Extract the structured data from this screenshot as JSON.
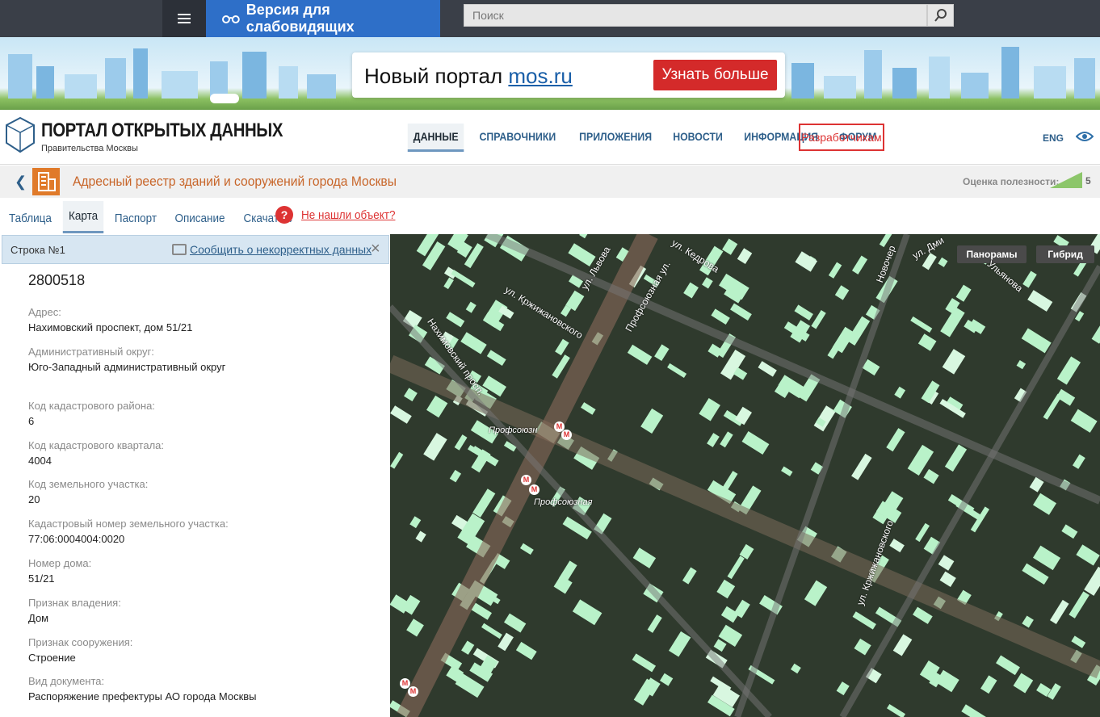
{
  "topbar": {
    "accessibility_label": "Версия для слабовидящих",
    "search_placeholder": "Поиск"
  },
  "banner": {
    "text_prefix": "Новый портал ",
    "text_link": "mos.ru",
    "button": "Узнать больше"
  },
  "header": {
    "title": "ПОРТАЛ ОТКРЫТЫХ ДАННЫХ",
    "subtitle": "Правительства Москвы",
    "nav": [
      "ДАННЫЕ",
      "СПРАВОЧНИКИ",
      "ПРИЛОЖЕНИЯ",
      "НОВОСТИ",
      "ИНФОРМАЦИЯ",
      "ФОРУМ"
    ],
    "dev_button": "Разработчикам",
    "lang": "ENG"
  },
  "dataset": {
    "title": "Адресный реестр зданий и сооружений города Москвы",
    "rating_label": "Оценка полезности:",
    "rating_value": "5"
  },
  "tabs": {
    "items": [
      "Таблица",
      "Карта",
      "Паспорт",
      "Описание",
      "Скачать"
    ],
    "not_found": "Не нашли объект?",
    "help": "?"
  },
  "panel": {
    "row_label": "Строка №1",
    "report_link": "Сообщить о некорректных данных",
    "id": "2800518",
    "fields": [
      {
        "label": "Адрес:",
        "value": "Нахимовский проспект, дом 51/21"
      },
      {
        "label": "Административный округ:",
        "value": "Юго-Западный административный округ"
      },
      {
        "label": "Код кадастрового района:",
        "value": "6"
      },
      {
        "label": "Код кадастрового квартала:",
        "value": "4004"
      },
      {
        "label": "Код земельного участка:",
        "value": "20"
      },
      {
        "label": "Кадастровый номер земельного участка:",
        "value": "77:06:0004004:0020"
      },
      {
        "label": "Номер дома:",
        "value": "51/21"
      },
      {
        "label": "Признак владения:",
        "value": "Дом"
      },
      {
        "label": "Признак сооружения:",
        "value": "Строение"
      },
      {
        "label": "Вид документа:",
        "value": "Распоряжение префектуры АО города Москвы"
      }
    ]
  },
  "map": {
    "buttons": [
      "Панорамы",
      "Гибрид"
    ],
    "streets": [
      "ул. Кедрова",
      "ул. Дми",
      "Ульянова",
      "Новочер",
      "ул. Львова",
      "ул. Кржижановского",
      "Профсоюзная ул.",
      "Нахимовский просп.",
      "ул. Кржижановского"
    ],
    "metro": [
      "Профсоюзн",
      "Профсоюзная"
    ],
    "metro_symbol": "М"
  }
}
